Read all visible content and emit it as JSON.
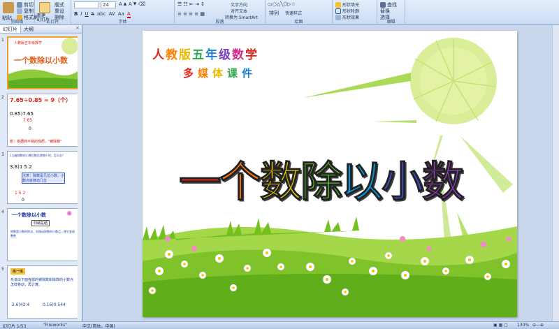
{
  "ribbon": {
    "clipboard": {
      "paste": "粘贴",
      "cut": "剪切",
      "copy": "复制",
      "format_painter": "格式刷",
      "group": "剪贴板"
    },
    "slides": {
      "new_slide": "新建\n幻灯片",
      "layout": "版式",
      "reset": "重设",
      "delete": "删除",
      "group": "幻灯片"
    },
    "font": {
      "size": "24",
      "bold": "B",
      "italic": "I",
      "underline": "U",
      "strike": "S",
      "shadow": "abc",
      "spacing": "AV",
      "case": "Aa",
      "color": "A",
      "group": "字体"
    },
    "paragraph": {
      "text_direction": "文字方向",
      "align_text": "对齐文本",
      "smartart": "转换为 SmartArt",
      "group": "段落"
    },
    "drawing": {
      "arrange": "排列",
      "quick_styles": "快速样式",
      "shape_fill": "形状填充",
      "shape_outline": "形状轮廓",
      "shape_effects": "形状效果",
      "group": "绘图"
    },
    "editing": {
      "find": "查找",
      "replace": "替换",
      "select": "选择",
      "group": "编辑"
    }
  },
  "left_pane": {
    "tabs": [
      "幻灯片",
      "大纲"
    ],
    "close": "×",
    "thumbnails": [
      {
        "num": "1",
        "title": "一个数除以小数",
        "sub": "人教版五年级数学"
      },
      {
        "num": "2",
        "line1": "7.65÷0.85 = 9（个）",
        "line2": "0.85)7.65",
        "line3": "7 65",
        "line4": "0",
        "note": "想：依据商不变的性质，\"被除数\""
      },
      {
        "num": "3",
        "line1": "1.当被除数的小数位数比除数少时，怎么办？",
        "line2": "3.8)1 5.2",
        "box": "注意：除数是几位小数，小数点就移动几位",
        "line3": "1 5 2",
        "line4": "0"
      },
      {
        "num": "4",
        "title": "一个数除以小数",
        "badge": "归纳总结",
        "body": "除数是小数的除法，先移动除数的小数点，使它变成整数"
      },
      {
        "num": "5",
        "badge": "练一练",
        "body": "先说出下面各题的被除数和除数的小数点怎样移动，再计算。",
        "items": [
          "2.6)42.4",
          "0.16)0.544"
        ]
      }
    ]
  },
  "slide": {
    "subtitle_line1": "人教版五年级数学",
    "subtitle_line2": "多媒体课件",
    "title_chars": [
      "一",
      "个",
      "数",
      "除",
      "以",
      "小",
      "数"
    ],
    "title_colors": [
      "#e2231a",
      "#ff7f00",
      "#f5d000",
      "#5cb531",
      "#00a0e9",
      "#3b4cc0",
      "#9b3cc9"
    ],
    "subtitle_colors": [
      "#e2231a",
      "#ff7f00",
      "#e6b800",
      "#2fa84f",
      "#1f7fd6",
      "#7a3fbf",
      "#d62a8a",
      "#e2231a"
    ]
  },
  "status_bar": {
    "slide_pos": "幻灯片 1/53",
    "theme": "\"Fireworks\"",
    "language": "中文(简体，中国)",
    "zoom": "130%"
  }
}
